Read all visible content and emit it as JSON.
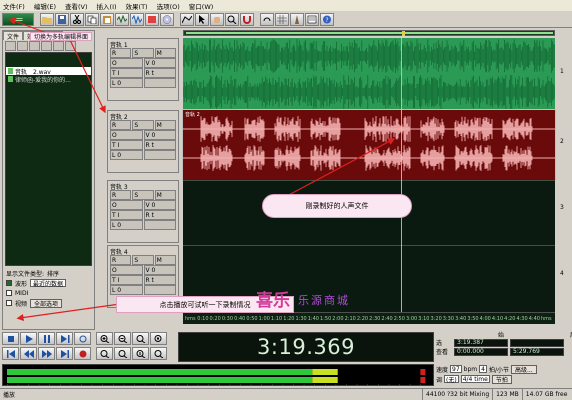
{
  "menu": [
    "文件(F)",
    "编辑(E)",
    "查看(V)",
    "插入(I)",
    "效果(T)",
    "选项(O)",
    "窗口(W)"
  ],
  "file_panel": {
    "tabs": [
      "文件",
      "效果",
      "常用"
    ],
    "files": [
      {
        "name": "音轨　2.wav",
        "selected": true
      },
      {
        "name": "律师函-爱我的你的...",
        "selected": false
      }
    ],
    "show_label": "显示文件类型:",
    "sort_label": "排序",
    "types": [
      {
        "label": "波形",
        "checked": true
      },
      {
        "label": "MIDI",
        "checked": false
      },
      {
        "label": "视频",
        "checked": false
      }
    ],
    "sort_value": "最近的数据",
    "options_button": "全部选项"
  },
  "tracks": [
    {
      "name": "音轨 1",
      "label": "",
      "num": "1"
    },
    {
      "name": "音轨 2",
      "label": "音轨 2",
      "num": "2"
    },
    {
      "name": "音轨 3",
      "label": "",
      "num": "3"
    },
    {
      "name": "音轨 4",
      "label": "",
      "num": "4"
    }
  ],
  "track_controls": {
    "r": "R",
    "s": "S",
    "m": "M",
    "o": "O",
    "v": "V 0",
    "ti": "T I",
    "l": "L 0",
    "rt": "R t"
  },
  "ruler_ticks": [
    "hms",
    "0:10",
    "0:20",
    "0:30",
    "0:40",
    "0:50",
    "1:00",
    "1:10",
    "1:20",
    "1:30",
    "1:40",
    "1:50",
    "2:00",
    "2:10",
    "2:20",
    "2:30",
    "2:40",
    "2:50",
    "3:00",
    "3:10",
    "3:20",
    "3:30",
    "3:40",
    "3:50",
    "4:00",
    "4:10",
    "4:20",
    "4:30",
    "4:40",
    "hms"
  ],
  "time_display": "3:19.369",
  "selection": {
    "start_label": "始",
    "end_label": "尾",
    "sel_label": "选",
    "view_label": "查看",
    "sel_start": "3:19.387",
    "sel_end": "",
    "view_start": "0:00.000",
    "view_end": "5:29.769",
    "len": "5:29.769"
  },
  "zoom": {
    "tempo_label": "速度",
    "tempo_value": "97",
    "bpm": "bpm",
    "beats": "4",
    "beats_label": "拍/小节",
    "key_label": "调",
    "key_value": "(无)",
    "time_sig": "4/4 time",
    "advanced": "高级...",
    "metronome": "节拍"
  },
  "status": {
    "left": "播放",
    "format": "44100 ?32 bit Mixing",
    "size": "123 MB",
    "free": "14.07 GB free"
  },
  "annotations": {
    "callout_track": "刚录制好的人声文件",
    "callout_play": "点击播放可试听一下录制情况",
    "callout_mode": "切换为多轨编辑界面",
    "watermark1": "喜乐",
    "watermark2": "乐源商城"
  },
  "colors": {
    "track1_wave": "#2a9a55",
    "track2_wave": "#f4b0b0",
    "track2_bg": "#6a0a0a",
    "arrow": "#e02020"
  },
  "playhead_time": "3:19.369",
  "meter_level": 0.72
}
